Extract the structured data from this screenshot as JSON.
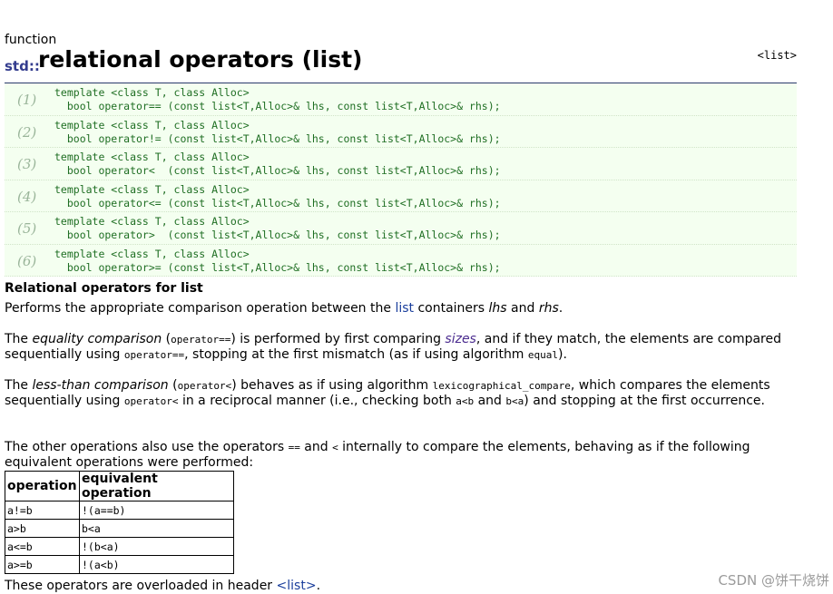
{
  "page": {
    "kind": "function",
    "namespace": "std::",
    "title": "relational operators (list)",
    "header_link": "<list>"
  },
  "prototypes": [
    {
      "num": "(1)",
      "line1": "template <class T, class Alloc>",
      "line2": "  bool operator== (const list<T,Alloc>& lhs, const list<T,Alloc>& rhs);"
    },
    {
      "num": "(2)",
      "line1": "template <class T, class Alloc>",
      "line2": "  bool operator!= (const list<T,Alloc>& lhs, const list<T,Alloc>& rhs);"
    },
    {
      "num": "(3)",
      "line1": "template <class T, class Alloc>",
      "line2": "  bool operator<  (const list<T,Alloc>& lhs, const list<T,Alloc>& rhs);"
    },
    {
      "num": "(4)",
      "line1": "template <class T, class Alloc>",
      "line2": "  bool operator<= (const list<T,Alloc>& lhs, const list<T,Alloc>& rhs);"
    },
    {
      "num": "(5)",
      "line1": "template <class T, class Alloc>",
      "line2": "  bool operator>  (const list<T,Alloc>& lhs, const list<T,Alloc>& rhs);"
    },
    {
      "num": "(6)",
      "line1": "template <class T, class Alloc>",
      "line2": "  bool operator>= (const list<T,Alloc>& lhs, const list<T,Alloc>& rhs);"
    }
  ],
  "section_title": "Relational operators for list",
  "p1": {
    "a": "Performs the appropriate comparison operation between the ",
    "link": "list",
    "b": " containers ",
    "lhs": "lhs",
    "c": " and ",
    "rhs": "rhs",
    "d": "."
  },
  "p2": {
    "a": "The ",
    "em": "equality comparison",
    "b": " (",
    "code1": "operator==",
    "c": ") is performed by first comparing ",
    "link": "sizes",
    "d": ", and if they match, the elements are compared sequentially using ",
    "code2": "operator==",
    "e": ", stopping at the first mismatch (as if using algorithm ",
    "code3": "equal",
    "f": ")."
  },
  "p3": {
    "a": "The ",
    "em": "less-than comparison",
    "b": " (",
    "code1": "operator<",
    "c": ") behaves as if using algorithm ",
    "code2": "lexicographical_compare",
    "d": ", which compares the elements sequentially using ",
    "code3": "operator<",
    "e": " in a reciprocal manner (i.e., checking both ",
    "code4": "a<b",
    "f": " and ",
    "code5": "b<a",
    "g": ") and stopping at the first occurrence."
  },
  "p4": {
    "a": "The other operations also use the operators ",
    "code1": "==",
    "b": " and ",
    "code2": "<",
    "c": " internally to compare the elements, behaving as if the following equivalent operations were performed:"
  },
  "table": {
    "headers": [
      "operation",
      "equivalent operation"
    ],
    "rows": [
      [
        "a!=b",
        "!(a==b)"
      ],
      [
        "a>b",
        "b<a"
      ],
      [
        "a<=b",
        "!(b<a)"
      ],
      [
        "a>=b",
        "!(a<b)"
      ]
    ]
  },
  "p5": {
    "a": "These operators are overloaded in header ",
    "link": "<list>",
    "b": "."
  },
  "watermark": "CSDN @饼干烧饼"
}
